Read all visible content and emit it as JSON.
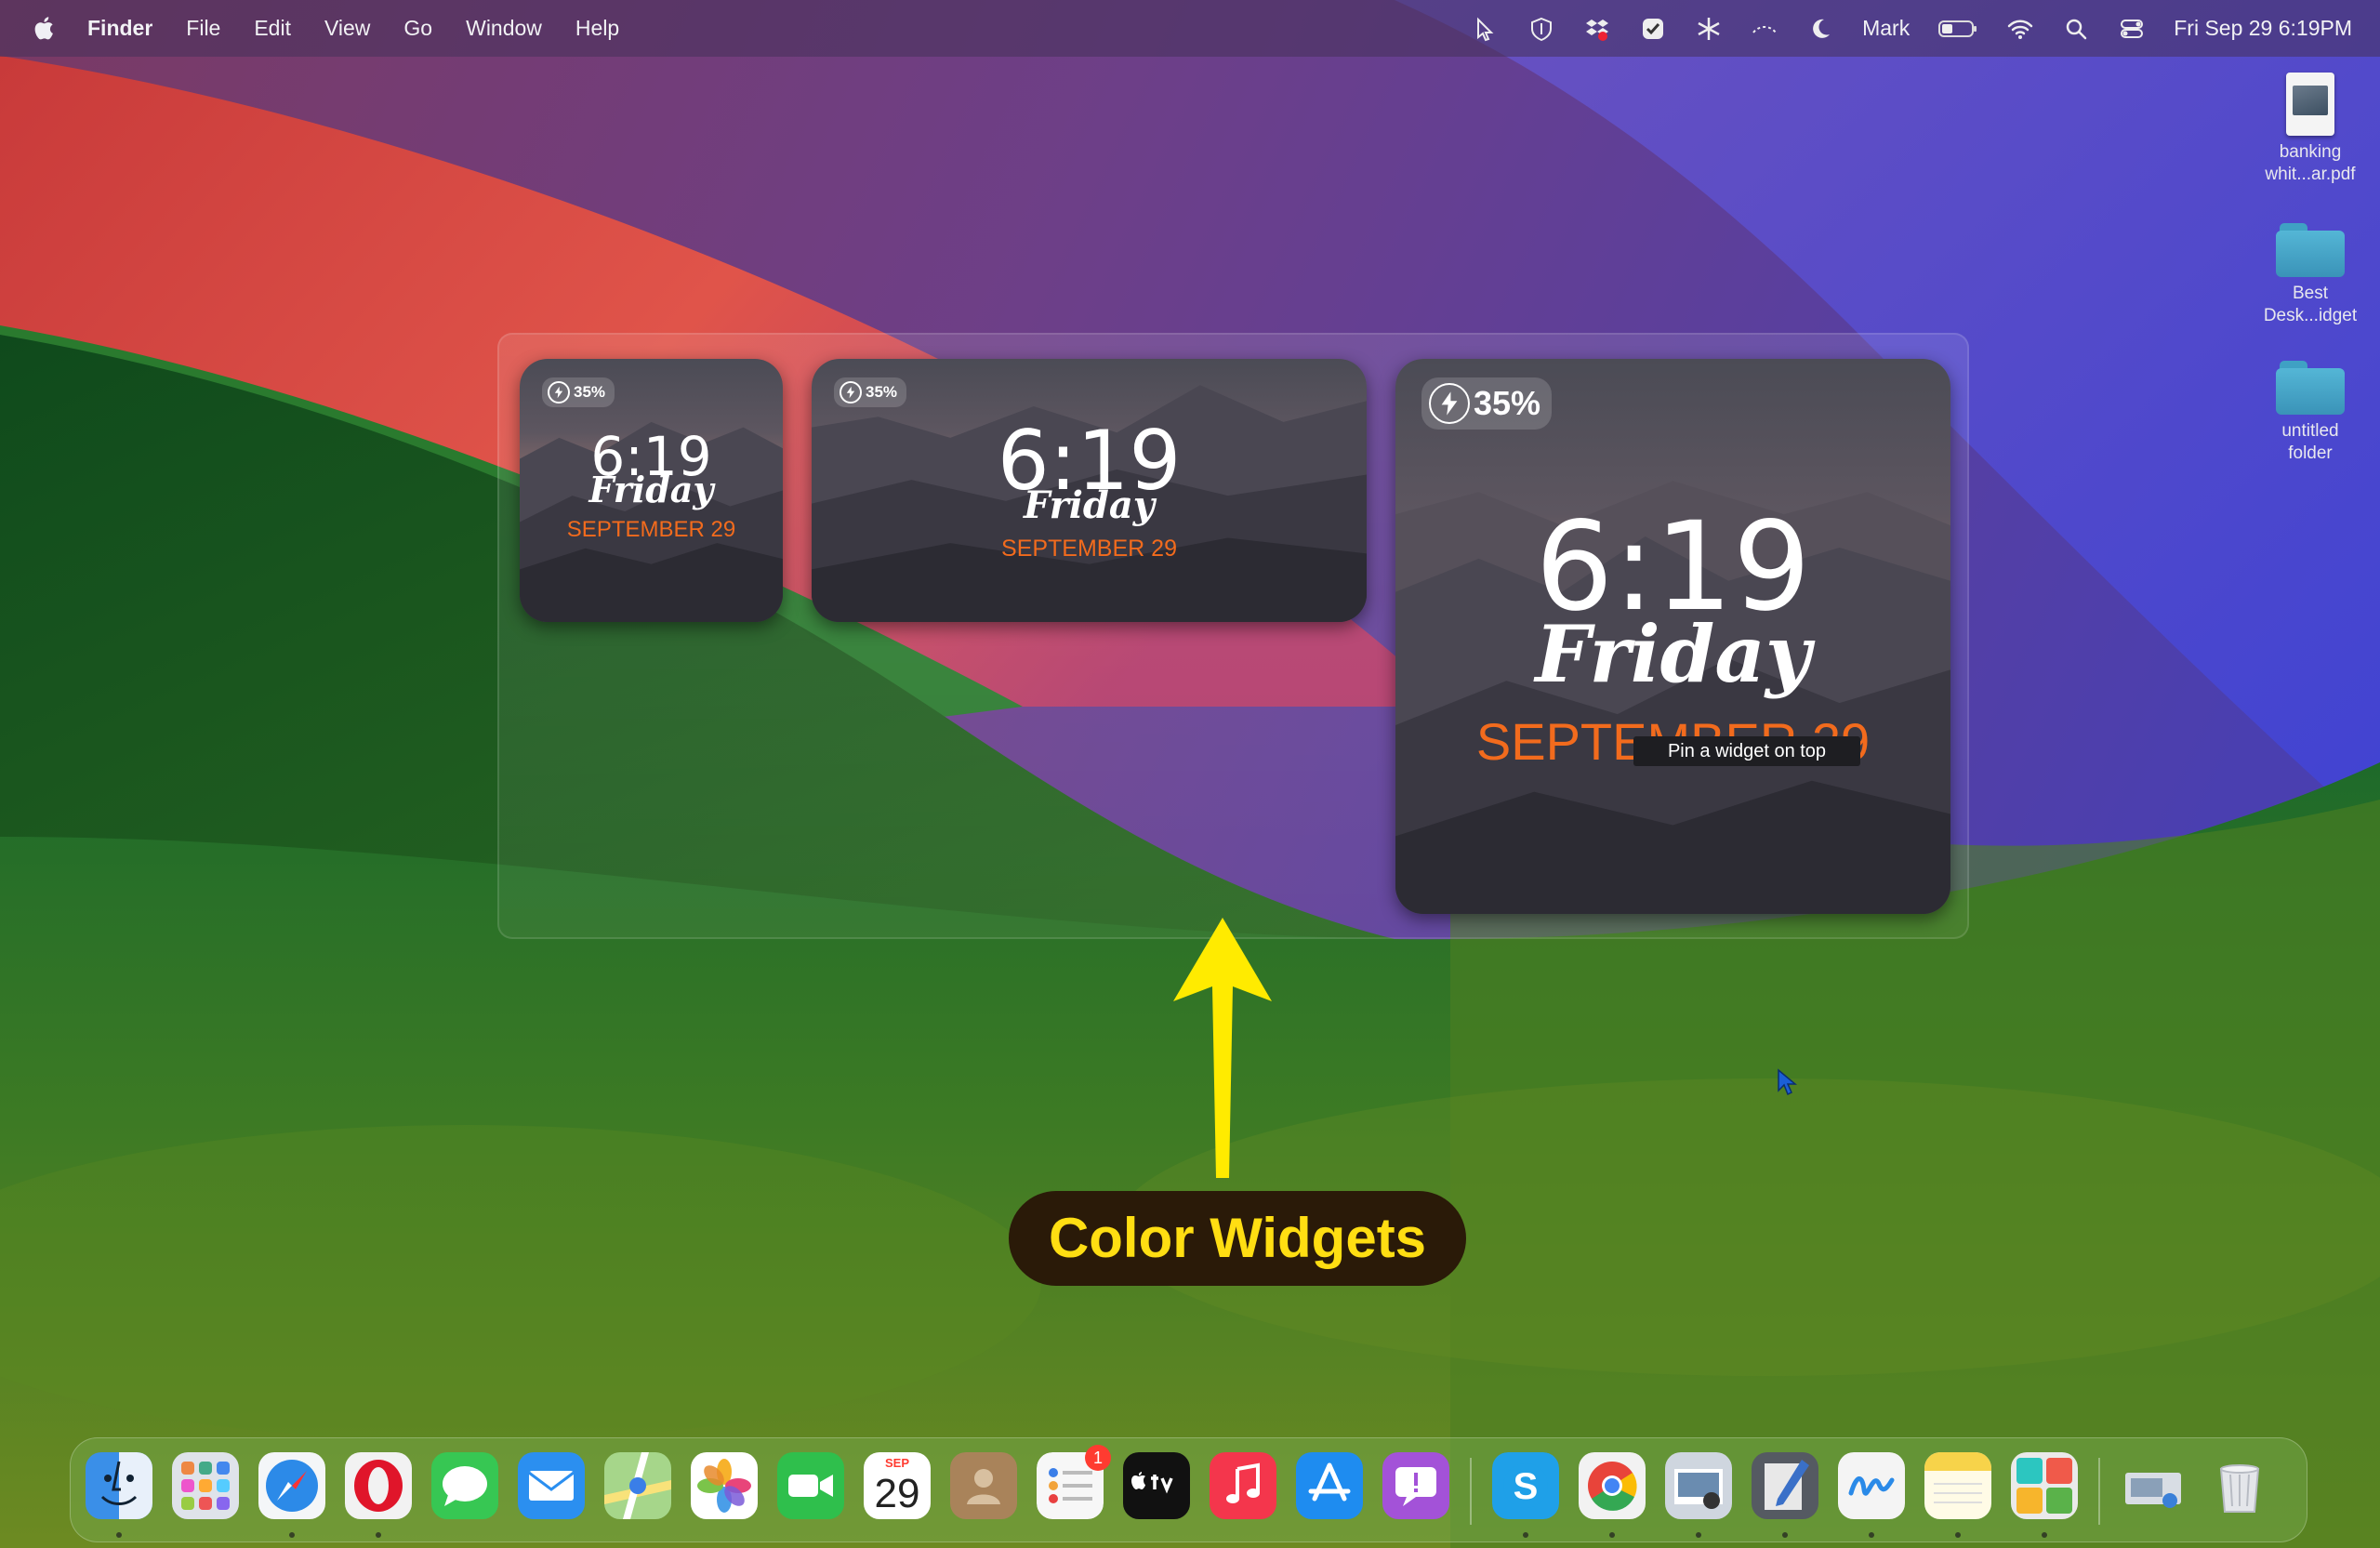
{
  "menubar": {
    "app_name": "Finder",
    "menus": [
      "File",
      "Edit",
      "View",
      "Go",
      "Window",
      "Help"
    ],
    "user": "Mark",
    "datetime": "Fri Sep 29  6:19PM"
  },
  "desktop_items": [
    {
      "label_line1": "banking",
      "label_line2": "whit...ar.pdf",
      "icon": "pdf-document-icon"
    },
    {
      "label_line1": "Best",
      "label_line2": "Desk...idget",
      "icon": "folder-icon"
    },
    {
      "label_line1": "untitled",
      "label_line2": "folder",
      "icon": "folder-icon"
    }
  ],
  "widgets": {
    "small": {
      "battery": "35%",
      "time": "6:19",
      "day": "Friday",
      "date": "SEPTEMBER 29"
    },
    "medium": {
      "battery": "35%",
      "time": "6:19",
      "day": "Friday",
      "date": "SEPTEMBER 29"
    },
    "large": {
      "battery": "35%",
      "time": "6:19",
      "day": "Friday",
      "date": "SEPTEMBER 29"
    },
    "tooltip": "Pin a widget on top",
    "accent_color": "#f26b1d"
  },
  "annotation": {
    "label": "Color Widgets",
    "color": "#ffde12"
  },
  "calendar_icon": {
    "month": "SEP",
    "day": "29"
  },
  "reminders_badge": "1",
  "dock_apps": [
    "finder-icon",
    "launchpad-icon",
    "safari-icon",
    "opera-icon",
    "messages-icon",
    "mail-icon",
    "maps-icon",
    "photos-icon",
    "facetime-icon",
    "calendar-icon",
    "contacts-icon",
    "reminders-icon",
    "apple-tv-icon",
    "music-icon",
    "app-store-icon",
    "feedback-icon",
    "skype-icon",
    "chrome-icon",
    "preview-icon",
    "script-editor-icon",
    "freeform-icon",
    "notes-icon",
    "color-widgets-icon",
    "image-capture-icon",
    "trash-icon"
  ]
}
